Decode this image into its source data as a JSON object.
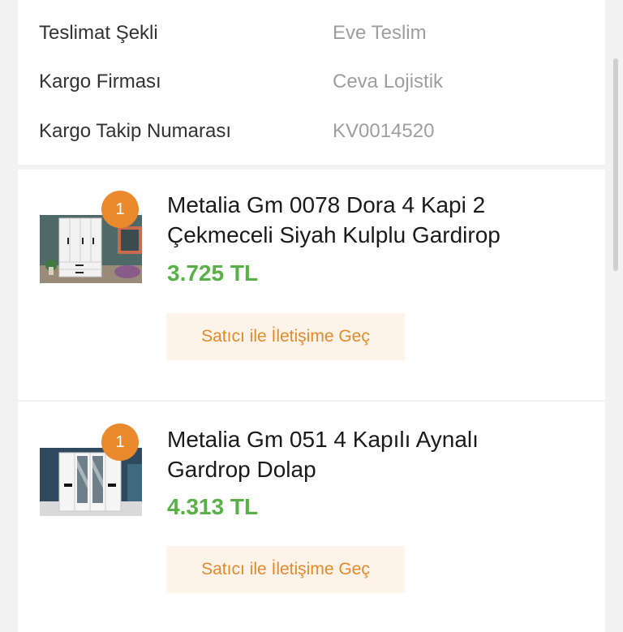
{
  "shipment": {
    "rows": [
      {
        "label": "Teslimat Şekli",
        "value": "Eve Teslim"
      },
      {
        "label": "Kargo Firması",
        "value": "Ceva Lojistik"
      },
      {
        "label": "Kargo Takip Numarası",
        "value": "KV0014520"
      }
    ]
  },
  "products": [
    {
      "quantity": "1",
      "title_line1": "Metalia Gm 0078 Dora 4 Kapi 2",
      "title_line2": "Çekmeceli Siyah Kulplu Gardirop",
      "price": "3.725 TL",
      "contact_label": "Satıcı ile İletişime Geç"
    },
    {
      "quantity": "1",
      "title_line1": "Metalia Gm 051 4 Kapılı Aynalı",
      "title_line2": "Gardrop Dolap",
      "price": "4.313 TL",
      "contact_label": "Satıcı ile İletişime Geç"
    }
  ],
  "colors": {
    "accent": "#ea8a2c",
    "price": "#58b047",
    "button_bg": "#fdf3e8"
  },
  "icons": {
    "product_1_image": "wardrobe-white-photo",
    "product_2_image": "wardrobe-mirrored-photo"
  }
}
